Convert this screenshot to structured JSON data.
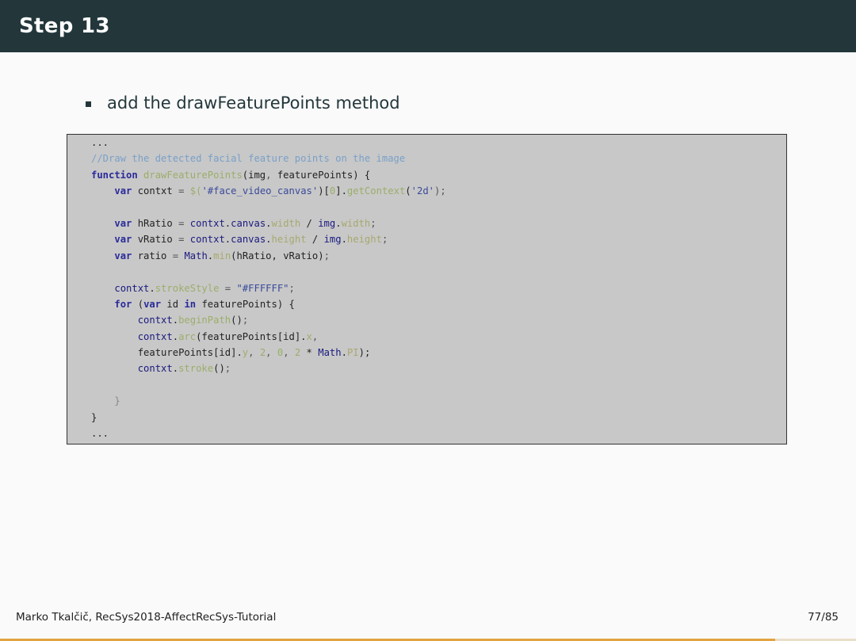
{
  "slide": {
    "title": "Step 13",
    "bullet": "add the drawFeaturePoints method"
  },
  "code": {
    "lines": [
      [
        {
          "t": "...",
          "c": "c-plain"
        }
      ],
      [
        {
          "t": "//Draw the detected facial feature points on the image",
          "c": "c-comment"
        }
      ],
      [
        {
          "t": "function",
          "c": "c-kw"
        },
        {
          "t": " ",
          "c": "c-plain"
        },
        {
          "t": "drawFeaturePoints",
          "c": "c-fn"
        },
        {
          "t": "(img",
          "c": "c-plain"
        },
        {
          "t": ", ",
          "c": "c-punc"
        },
        {
          "t": "featurePoints) {",
          "c": "c-plain"
        }
      ],
      [
        {
          "t": "    ",
          "c": "c-plain"
        },
        {
          "t": "var",
          "c": "c-kw"
        },
        {
          "t": " contxt ",
          "c": "c-plain"
        },
        {
          "t": "= ",
          "c": "c-punc"
        },
        {
          "t": "$(",
          "c": "c-fn"
        },
        {
          "t": "'#face_video_canvas'",
          "c": "c-str"
        },
        {
          "t": ")[",
          "c": "c-plain"
        },
        {
          "t": "0",
          "c": "c-num"
        },
        {
          "t": "].",
          "c": "c-plain"
        },
        {
          "t": "getContext",
          "c": "c-fn"
        },
        {
          "t": "(",
          "c": "c-plain"
        },
        {
          "t": "'2d'",
          "c": "c-str"
        },
        {
          "t": ");",
          "c": "c-punc"
        }
      ],
      [
        {
          "t": "",
          "c": "c-plain"
        }
      ],
      [
        {
          "t": "    ",
          "c": "c-plain"
        },
        {
          "t": "var",
          "c": "c-kw"
        },
        {
          "t": " hRatio ",
          "c": "c-plain"
        },
        {
          "t": "= ",
          "c": "c-punc"
        },
        {
          "t": "contxt",
          "c": "c-var"
        },
        {
          "t": ".",
          "c": "c-plain"
        },
        {
          "t": "canvas",
          "c": "c-var"
        },
        {
          "t": ".",
          "c": "c-plain"
        },
        {
          "t": "width",
          "c": "c-prop"
        },
        {
          "t": " / ",
          "c": "c-plain"
        },
        {
          "t": "img",
          "c": "c-var"
        },
        {
          "t": ".",
          "c": "c-plain"
        },
        {
          "t": "width",
          "c": "c-prop"
        },
        {
          "t": ";",
          "c": "c-punc"
        }
      ],
      [
        {
          "t": "    ",
          "c": "c-plain"
        },
        {
          "t": "var",
          "c": "c-kw"
        },
        {
          "t": " vRatio ",
          "c": "c-plain"
        },
        {
          "t": "= ",
          "c": "c-punc"
        },
        {
          "t": "contxt",
          "c": "c-var"
        },
        {
          "t": ".",
          "c": "c-plain"
        },
        {
          "t": "canvas",
          "c": "c-var"
        },
        {
          "t": ".",
          "c": "c-plain"
        },
        {
          "t": "height",
          "c": "c-prop"
        },
        {
          "t": " / ",
          "c": "c-plain"
        },
        {
          "t": "img",
          "c": "c-var"
        },
        {
          "t": ".",
          "c": "c-plain"
        },
        {
          "t": "height",
          "c": "c-prop"
        },
        {
          "t": ";",
          "c": "c-punc"
        }
      ],
      [
        {
          "t": "    ",
          "c": "c-plain"
        },
        {
          "t": "var",
          "c": "c-kw"
        },
        {
          "t": " ratio ",
          "c": "c-plain"
        },
        {
          "t": "= ",
          "c": "c-punc"
        },
        {
          "t": "Math",
          "c": "c-var"
        },
        {
          "t": ".",
          "c": "c-plain"
        },
        {
          "t": "min",
          "c": "c-prop"
        },
        {
          "t": "(hRatio, vRatio)",
          "c": "c-plain"
        },
        {
          "t": ";",
          "c": "c-punc"
        }
      ],
      [
        {
          "t": "",
          "c": "c-plain"
        }
      ],
      [
        {
          "t": "    ",
          "c": "c-plain"
        },
        {
          "t": "contxt",
          "c": "c-var"
        },
        {
          "t": ".",
          "c": "c-plain"
        },
        {
          "t": "strokeStyle",
          "c": "c-fn"
        },
        {
          "t": " = ",
          "c": "c-punc"
        },
        {
          "t": "\"#FFFFFF\"",
          "c": "c-str"
        },
        {
          "t": ";",
          "c": "c-punc"
        }
      ],
      [
        {
          "t": "    ",
          "c": "c-plain"
        },
        {
          "t": "for",
          "c": "c-kw"
        },
        {
          "t": " (",
          "c": "c-plain"
        },
        {
          "t": "var",
          "c": "c-kw"
        },
        {
          "t": " id ",
          "c": "c-plain"
        },
        {
          "t": "in",
          "c": "c-kw"
        },
        {
          "t": " featurePoints) {",
          "c": "c-plain"
        }
      ],
      [
        {
          "t": "        ",
          "c": "c-plain"
        },
        {
          "t": "contxt",
          "c": "c-var"
        },
        {
          "t": ".",
          "c": "c-plain"
        },
        {
          "t": "beginPath",
          "c": "c-fn"
        },
        {
          "t": "()",
          "c": "c-plain"
        },
        {
          "t": ";",
          "c": "c-punc"
        }
      ],
      [
        {
          "t": "        ",
          "c": "c-plain"
        },
        {
          "t": "contxt",
          "c": "c-var"
        },
        {
          "t": ".",
          "c": "c-plain"
        },
        {
          "t": "arc",
          "c": "c-fn"
        },
        {
          "t": "(featurePoints[id].",
          "c": "c-plain"
        },
        {
          "t": "x",
          "c": "c-prop"
        },
        {
          "t": ",",
          "c": "c-punc"
        }
      ],
      [
        {
          "t": "        ",
          "c": "c-plain"
        },
        {
          "t": "featurePoints[id].",
          "c": "c-plain"
        },
        {
          "t": "y",
          "c": "c-prop"
        },
        {
          "t": ", ",
          "c": "c-punc"
        },
        {
          "t": "2",
          "c": "c-num"
        },
        {
          "t": ", ",
          "c": "c-punc"
        },
        {
          "t": "0",
          "c": "c-num"
        },
        {
          "t": ", ",
          "c": "c-punc"
        },
        {
          "t": "2",
          "c": "c-num"
        },
        {
          "t": " * ",
          "c": "c-plain"
        },
        {
          "t": "Math",
          "c": "c-var"
        },
        {
          "t": ".",
          "c": "c-plain"
        },
        {
          "t": "PI",
          "c": "c-prop"
        },
        {
          "t": ");",
          "c": "c-plain"
        }
      ],
      [
        {
          "t": "        ",
          "c": "c-plain"
        },
        {
          "t": "contxt",
          "c": "c-var"
        },
        {
          "t": ".",
          "c": "c-plain"
        },
        {
          "t": "stroke",
          "c": "c-fn"
        },
        {
          "t": "()",
          "c": "c-plain"
        },
        {
          "t": ";",
          "c": "c-punc"
        }
      ],
      [
        {
          "t": "",
          "c": "c-plain"
        }
      ],
      [
        {
          "t": "    ",
          "c": "c-plain"
        },
        {
          "t": "}",
          "c": "c-weak"
        }
      ],
      [
        {
          "t": "}",
          "c": "c-plain"
        }
      ],
      [
        {
          "t": "...",
          "c": "c-plain"
        }
      ]
    ]
  },
  "footer": {
    "author": "Marko Tkalčič, RecSys2018-AffectRecSys-Tutorial",
    "page": "77/85"
  },
  "progress": {
    "current": 77,
    "total": 85
  },
  "colors": {
    "titlebar": "#23373b",
    "code_background": "#c8c8c8",
    "progress_fill": "#e2a340"
  }
}
